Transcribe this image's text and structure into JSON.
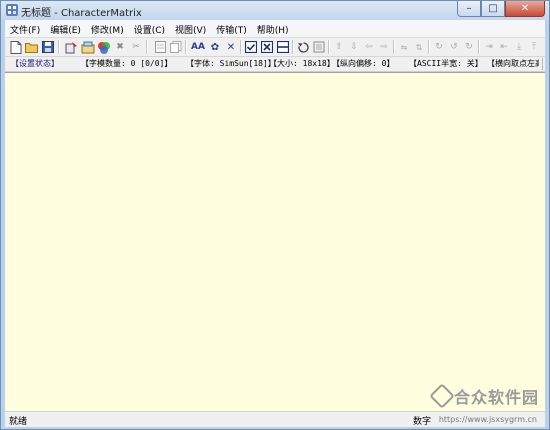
{
  "window": {
    "title": "无标题 - CharacterMatrix",
    "minimize_label": "–",
    "maximize_label": "□",
    "close_label": "✕"
  },
  "menu": [
    {
      "label": "文件(F)"
    },
    {
      "label": "编辑(E)"
    },
    {
      "label": "修改(M)"
    },
    {
      "label": "设置(C)"
    },
    {
      "label": "视图(V)"
    },
    {
      "label": "传输(T)"
    },
    {
      "label": "帮助(H)"
    }
  ],
  "toolbar": {
    "aa_label": "AA"
  },
  "status_info": {
    "set_state": "【设置状态】",
    "glyph_count": "【字模数量: 0 [0/0]】",
    "font": "【字体: SimSun[18]】",
    "size": "【大小: 18x18】",
    "vertical_offset": "【纵向偏移: 0】",
    "ascii_half": "【ASCII半宽: 关】",
    "mode": "【横向取点左高位 模式】"
  },
  "statusbar": {
    "left": "就绪",
    "right": "数字"
  },
  "watermark": {
    "text": "合众软件园",
    "url": "https://www.jsxsygrm.cn"
  }
}
